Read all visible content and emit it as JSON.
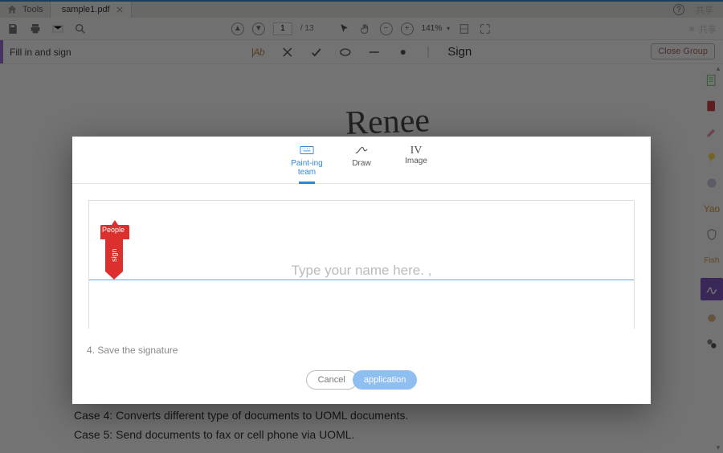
{
  "tabbar": {
    "home_label": "Tools",
    "filename": "sample1.pdf",
    "share_label": "共享"
  },
  "toolbar": {
    "page_current": "1",
    "page_total": "/ 13",
    "zoom": "141%",
    "right_label": "共享"
  },
  "fillrow": {
    "label": "Fill in and sign",
    "ab_label": "|Ab",
    "sign_label": "Sign",
    "close_label": "Close Group"
  },
  "document": {
    "sample_signature": "Renee",
    "case4": "Case 4: Converts different type of documents to UOML documents.",
    "case5": "Case 5: Send documents to fax or cell phone via UOML."
  },
  "rail": {
    "yao": "Yao",
    "fish": "Fish"
  },
  "modal": {
    "tab_type": "Paint-ing team",
    "tab_draw": "Draw",
    "tab_image_iv": "IV",
    "tab_image": "Image",
    "badge_top": "People",
    "badge_body": "sign",
    "placeholder": "Type your name here.  ,",
    "step": "4. Save the signature",
    "cancel": "Cancel",
    "apply": "application"
  }
}
